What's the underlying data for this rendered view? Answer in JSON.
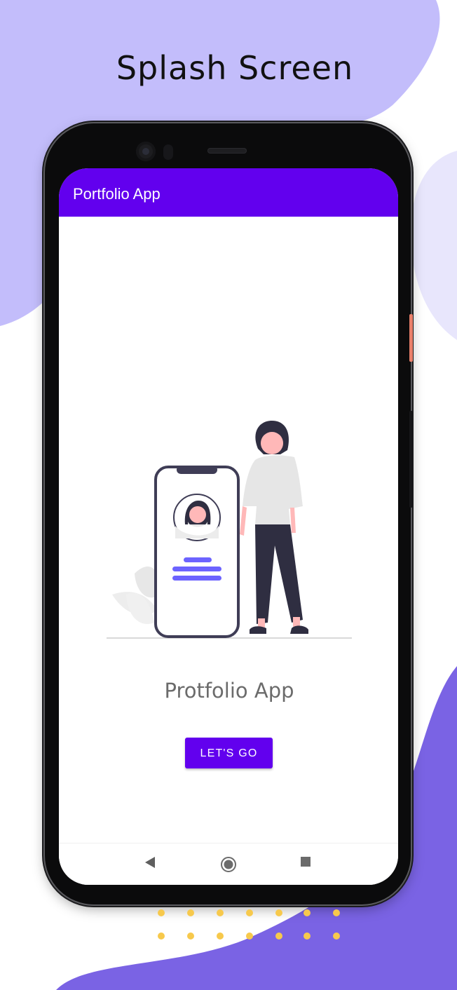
{
  "page": {
    "headline": "Splash Screen"
  },
  "app": {
    "appbar_title": "Portfolio App",
    "app_name": "Protfolio App",
    "cta_label": "LET'S GO"
  },
  "navbar": {
    "back_icon": "back-triangle-icon",
    "home_icon": "home-circle-icon",
    "recents_icon": "recents-square-icon"
  },
  "colors": {
    "primary": "#6200ee",
    "accent_figure": "#6c63ff",
    "background_blob_light": "#c3bdfb",
    "background_blob_dark": "#7a63e4",
    "dot_color": "#f7c94c"
  }
}
